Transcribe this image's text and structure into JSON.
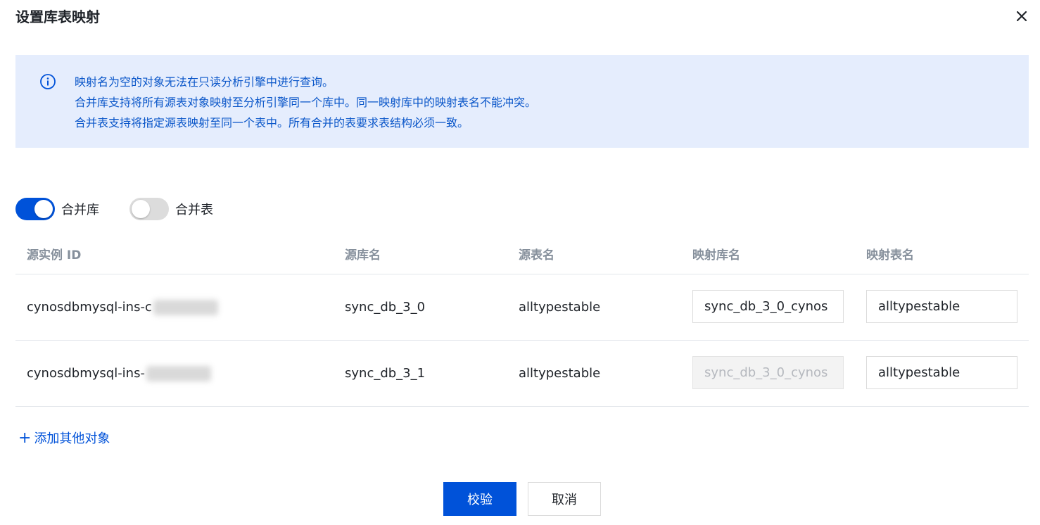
{
  "dialog": {
    "title": "设置库表映射",
    "close_icon": "close-icon"
  },
  "info": {
    "icon": "info-circle-icon",
    "lines": [
      "映射名为空的对象无法在只读分析引擎中进行查询。",
      "合并库支持将所有源表对象映射至分析引擎同一个库中。同一映射库中的映射表名不能冲突。",
      "合并表支持将指定源表映射至同一个表中。所有合并的表要求表结构必须一致。"
    ]
  },
  "toggles": {
    "merge_db": {
      "label": "合并库",
      "on": true
    },
    "merge_table": {
      "label": "合并表",
      "on": false
    }
  },
  "table": {
    "headers": [
      "源实例 ID",
      "源库名",
      "源表名",
      "映射库名",
      "映射表名"
    ],
    "rows": [
      {
        "instance": "cynosdbmysql-ins-c",
        "source_db": "sync_db_3_0",
        "source_table": "alltypestable",
        "mapped_db": "sync_db_3_0_cynos",
        "mapped_table": "alltypestable"
      },
      {
        "instance": "cynosdbmysql-ins-",
        "source_db": "sync_db_3_1",
        "source_table": "alltypestable",
        "mapped_db": "sync_db_3_0_cynos",
        "mapped_table": "alltypestable"
      }
    ]
  },
  "add_other": {
    "icon": "plus-icon",
    "label": "添加其他对象"
  },
  "buttons": {
    "verify": "校验",
    "cancel": "取消"
  },
  "colors": {
    "primary": "#0052d9",
    "info_bg": "#e5edfd",
    "info_text": "#0a56c9"
  }
}
